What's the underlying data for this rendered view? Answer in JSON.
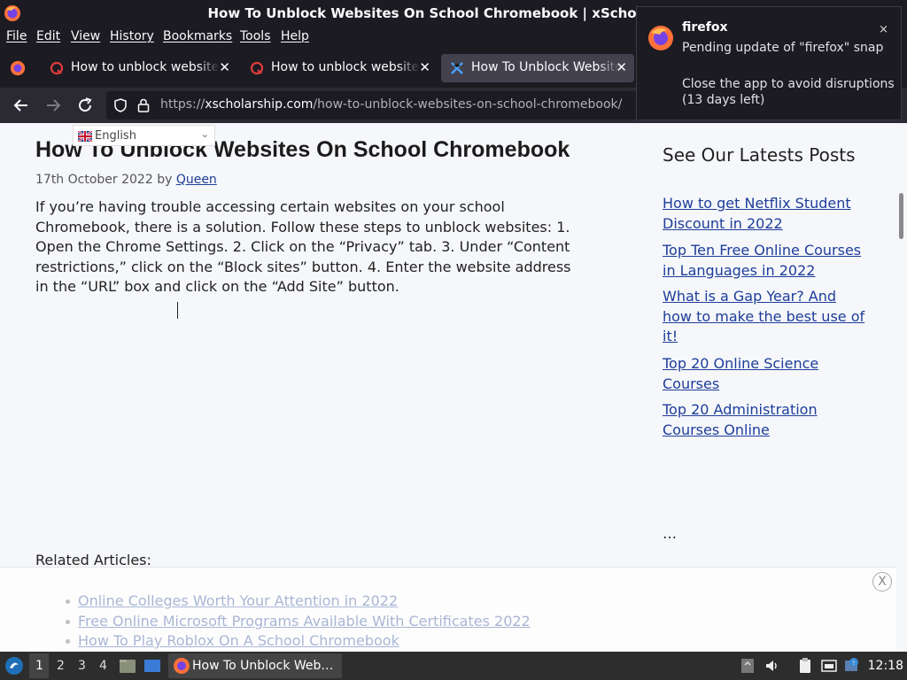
{
  "window": {
    "title": "How To Unblock Websites On School Chromebook | xScholarship –"
  },
  "menu": [
    "File",
    "Edit",
    "View",
    "History",
    "Bookmarks",
    "Tools",
    "Help"
  ],
  "tabs": [
    {
      "label": "How to unblock websites",
      "icon": "quora-icon",
      "active": false
    },
    {
      "label": "How to unblock websites",
      "icon": "quora-icon",
      "active": false
    },
    {
      "label": "How To Unblock Websites",
      "icon": "xscholarship-icon",
      "active": true
    }
  ],
  "url": {
    "scheme": "https://",
    "host": "xscholarship.com",
    "path": "/how-to-unblock-websites-on-school-chromebook/"
  },
  "language": {
    "label": "English"
  },
  "article": {
    "title": "How To Unblock Websites On School Chromebook",
    "date": "17th October 2022",
    "by": "by",
    "author": "Queen",
    "body": "If you’re having trouble accessing certain websites on your school Chromebook, there is a solution. Follow these steps to unblock websites: 1. Open the Chrome Settings. 2. Click on the “Privacy” tab. 3. Under “Content restrictions,” click on the “Block sites” button. 4. Enter the website address in the “URL” box and click on the “Add Site” button.",
    "related_heading": "Related Articles:",
    "related": [
      "Online Colleges Worth Your Attention in 2022",
      "Free Online Microsoft Programs Available With Certificates 2022",
      "How To Play Roblox On A School Chromebook"
    ]
  },
  "sidebar": {
    "title": "See Our Latests Posts",
    "posts": [
      "How to get Netflix Student Discount in 2022",
      "Top Ten Free Online Courses in Languages in 2022",
      "What is a Gap Year? And how to make the best use of it!",
      "Top 20 Online Science Courses",
      "Top 20 Administration Courses Online"
    ],
    "more": "…"
  },
  "overlay": {
    "close": "X"
  },
  "notification": {
    "app": "firefox",
    "line1": "Pending update of \"firefox\" snap",
    "line2": "Close the app to avoid disruptions (13 days left)",
    "close": "×"
  },
  "taskbar": {
    "workspaces": [
      "1",
      "2",
      "3",
      "4"
    ],
    "active_window": "How To Unblock Web…",
    "clock": "12:18"
  },
  "colors": {
    "link": "#1e3d9a",
    "chrome_dark": "#1c1b22",
    "page_bg": "#f5f7fa"
  }
}
